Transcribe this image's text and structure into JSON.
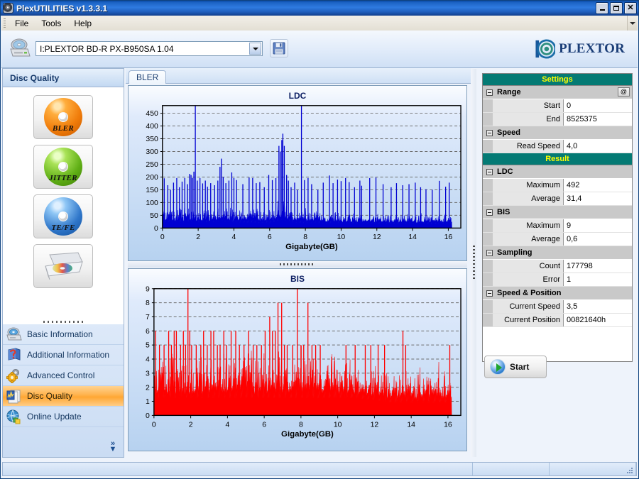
{
  "window": {
    "title": "PlexUTILITIES v1.3.3.1",
    "icon": "disc-icon",
    "buttons": {
      "minimize": "_",
      "maximize": "□",
      "close": "✕"
    }
  },
  "menu": {
    "items": [
      "File",
      "Tools",
      "Help"
    ],
    "expander": "chevron-down-icon"
  },
  "toolbar": {
    "drive_icon": "optical-drive-icon",
    "drive_value": "I:PLEXTOR BD-R  PX-B950SA  1.04",
    "dropdown_icon": "chevron-down-icon",
    "save_icon": "floppy-save-icon",
    "brand": "PLEXTOR",
    "brand_suffix": "®"
  },
  "sidebar": {
    "header": "Disc Quality",
    "big_buttons": [
      {
        "name": "bler",
        "label": "BLER",
        "icon": "orange-disc-icon"
      },
      {
        "name": "jitter",
        "label": "JITTER",
        "icon": "green-disc-icon"
      },
      {
        "name": "tefe",
        "label": "TE/FE",
        "icon": "blue-disc-icon"
      },
      {
        "name": "drive",
        "label": "",
        "icon": "drive-tray-icon"
      }
    ],
    "nav": [
      {
        "label": "Basic Information",
        "icon": "disc-drive-icon",
        "selected": false
      },
      {
        "label": "Additional Information",
        "icon": "book-help-icon",
        "selected": false
      },
      {
        "label": "Advanced Control",
        "icon": "gears-icon",
        "selected": false
      },
      {
        "label": "Disc Quality",
        "icon": "chart-pages-icon",
        "selected": true
      },
      {
        "label": "Online Update",
        "icon": "globe-update-icon",
        "selected": false
      }
    ],
    "expander": "chevrons-down-icon"
  },
  "main": {
    "tabs": [
      {
        "label": "BLER",
        "active": true
      }
    ]
  },
  "properties": {
    "sections": [
      {
        "type": "category",
        "label": "Settings",
        "groups": [
          {
            "label": "Range",
            "action": "@",
            "rows": [
              {
                "key": "Start",
                "value": "0"
              },
              {
                "key": "End",
                "value": "8525375"
              }
            ]
          },
          {
            "label": "Speed",
            "action": "",
            "rows": [
              {
                "key": "Read Speed",
                "value": "4,0"
              }
            ]
          }
        ]
      },
      {
        "type": "category",
        "label": "Result",
        "groups": [
          {
            "label": "LDC",
            "action": "",
            "rows": [
              {
                "key": "Maximum",
                "value": "492"
              },
              {
                "key": "Average",
                "value": "31,4"
              }
            ]
          },
          {
            "label": "BIS",
            "action": "",
            "rows": [
              {
                "key": "Maximum",
                "value": "9"
              },
              {
                "key": "Average",
                "value": "0,6"
              }
            ]
          },
          {
            "label": "Sampling",
            "action": "",
            "rows": [
              {
                "key": "Count",
                "value": "177798"
              },
              {
                "key": "Error",
                "value": "1"
              }
            ]
          },
          {
            "label": "Speed & Position",
            "action": "",
            "rows": [
              {
                "key": "Current Speed",
                "value": "3,5"
              },
              {
                "key": "Current Position",
                "value": "00821640h"
              }
            ]
          }
        ]
      }
    ]
  },
  "start_button": {
    "label": "Start",
    "icon": "play-icon"
  },
  "statusbar": {
    "panels": [
      "",
      "",
      ""
    ],
    "sizegrip": "resize-grip-icon"
  },
  "chart_data": [
    {
      "type": "area",
      "title": "LDC",
      "xlabel": "Gigabyte(GB)",
      "ylabel": "",
      "color": "#0000d2",
      "xlim": [
        0,
        16.7
      ],
      "ylim": [
        0,
        480
      ],
      "xticks": [
        0,
        2,
        4,
        6,
        8,
        10,
        12,
        14,
        16
      ],
      "yticks": [
        0,
        50,
        100,
        150,
        200,
        250,
        300,
        350,
        400,
        450
      ],
      "grid": true,
      "legend": "none",
      "data_max": 492,
      "data_avg": 31.4,
      "baseline_envelope": [
        {
          "x": 0.0,
          "y": 78
        },
        {
          "x": 0.6,
          "y": 72
        },
        {
          "x": 1.2,
          "y": 70
        },
        {
          "x": 1.8,
          "y": 74
        },
        {
          "x": 2.6,
          "y": 68
        },
        {
          "x": 3.3,
          "y": 80
        },
        {
          "x": 4.0,
          "y": 70
        },
        {
          "x": 5.0,
          "y": 66
        },
        {
          "x": 6.0,
          "y": 64
        },
        {
          "x": 6.7,
          "y": 96
        },
        {
          "x": 7.4,
          "y": 68
        },
        {
          "x": 8.2,
          "y": 62
        },
        {
          "x": 9.3,
          "y": 58
        },
        {
          "x": 10.5,
          "y": 56
        },
        {
          "x": 11.1,
          "y": 60
        },
        {
          "x": 12.0,
          "y": 54
        },
        {
          "x": 13.0,
          "y": 52
        },
        {
          "x": 14.0,
          "y": 52
        },
        {
          "x": 15.0,
          "y": 50
        },
        {
          "x": 16.2,
          "y": 56
        }
      ],
      "spikes": [
        {
          "x": 0.1,
          "y": 195
        },
        {
          "x": 0.3,
          "y": 168
        },
        {
          "x": 0.45,
          "y": 150
        },
        {
          "x": 0.62,
          "y": 178
        },
        {
          "x": 0.8,
          "y": 196
        },
        {
          "x": 0.95,
          "y": 160
        },
        {
          "x": 1.1,
          "y": 182
        },
        {
          "x": 1.25,
          "y": 196
        },
        {
          "x": 1.4,
          "y": 172
        },
        {
          "x": 1.52,
          "y": 212
        },
        {
          "x": 1.6,
          "y": 208
        },
        {
          "x": 1.68,
          "y": 196
        },
        {
          "x": 1.76,
          "y": 221
        },
        {
          "x": 1.84,
          "y": 492
        },
        {
          "x": 1.95,
          "y": 186
        },
        {
          "x": 2.1,
          "y": 196
        },
        {
          "x": 2.25,
          "y": 175
        },
        {
          "x": 2.4,
          "y": 186
        },
        {
          "x": 2.52,
          "y": 162
        },
        {
          "x": 2.7,
          "y": 176
        },
        {
          "x": 2.92,
          "y": 168
        },
        {
          "x": 3.1,
          "y": 186
        },
        {
          "x": 3.22,
          "y": 240
        },
        {
          "x": 3.3,
          "y": 272
        },
        {
          "x": 3.4,
          "y": 200
        },
        {
          "x": 3.55,
          "y": 176
        },
        {
          "x": 3.72,
          "y": 186
        },
        {
          "x": 3.88,
          "y": 218
        },
        {
          "x": 4.0,
          "y": 196
        },
        {
          "x": 4.15,
          "y": 188
        },
        {
          "x": 4.5,
          "y": 172
        },
        {
          "x": 4.85,
          "y": 198
        },
        {
          "x": 5.05,
          "y": 196
        },
        {
          "x": 5.25,
          "y": 176
        },
        {
          "x": 5.45,
          "y": 180
        },
        {
          "x": 5.7,
          "y": 160
        },
        {
          "x": 5.95,
          "y": 208
        },
        {
          "x": 6.15,
          "y": 188
        },
        {
          "x": 6.35,
          "y": 196
        },
        {
          "x": 6.52,
          "y": 322
        },
        {
          "x": 6.6,
          "y": 300
        },
        {
          "x": 6.68,
          "y": 345
        },
        {
          "x": 6.74,
          "y": 370
        },
        {
          "x": 6.82,
          "y": 322
        },
        {
          "x": 6.95,
          "y": 208
        },
        {
          "x": 7.05,
          "y": 186
        },
        {
          "x": 7.2,
          "y": 160
        },
        {
          "x": 7.4,
          "y": 178
        },
        {
          "x": 7.55,
          "y": 150
        },
        {
          "x": 7.78,
          "y": 492
        },
        {
          "x": 7.95,
          "y": 188
        },
        {
          "x": 8.15,
          "y": 196
        },
        {
          "x": 8.35,
          "y": 172
        },
        {
          "x": 8.7,
          "y": 150
        },
        {
          "x": 9.0,
          "y": 178
        },
        {
          "x": 9.35,
          "y": 206
        },
        {
          "x": 9.55,
          "y": 176
        },
        {
          "x": 9.8,
          "y": 190
        },
        {
          "x": 10.0,
          "y": 184
        },
        {
          "x": 10.25,
          "y": 196
        },
        {
          "x": 10.45,
          "y": 180
        },
        {
          "x": 10.75,
          "y": 160
        },
        {
          "x": 11.05,
          "y": 186
        },
        {
          "x": 11.15,
          "y": 166
        },
        {
          "x": 11.6,
          "y": 196
        },
        {
          "x": 11.95,
          "y": 198
        },
        {
          "x": 12.35,
          "y": 172
        },
        {
          "x": 12.8,
          "y": 160
        },
        {
          "x": 13.1,
          "y": 176
        },
        {
          "x": 13.45,
          "y": 168
        },
        {
          "x": 13.8,
          "y": 172
        },
        {
          "x": 14.15,
          "y": 178
        },
        {
          "x": 14.45,
          "y": 160
        },
        {
          "x": 14.75,
          "y": 152
        },
        {
          "x": 15.1,
          "y": 150
        },
        {
          "x": 15.5,
          "y": 185
        },
        {
          "x": 15.85,
          "y": 162
        },
        {
          "x": 16.05,
          "y": 178
        }
      ]
    },
    {
      "type": "area",
      "title": "BIS",
      "xlabel": "Gigabyte(GB)",
      "ylabel": "",
      "color": "#fe0000",
      "xlim": [
        0,
        16.7
      ],
      "ylim": [
        0,
        9
      ],
      "xticks": [
        0,
        2,
        4,
        6,
        8,
        10,
        12,
        14,
        16
      ],
      "yticks": [
        0,
        1,
        2,
        3,
        4,
        5,
        6,
        7,
        8,
        9
      ],
      "grid": true,
      "legend": "none",
      "data_max": 9,
      "data_avg": 0.6,
      "baseline_envelope": [
        {
          "x": 0.0,
          "y": 4
        },
        {
          "x": 4.0,
          "y": 4
        },
        {
          "x": 8.0,
          "y": 4
        },
        {
          "x": 9.2,
          "y": 4
        },
        {
          "x": 11.0,
          "y": 4
        },
        {
          "x": 12.9,
          "y": 3
        },
        {
          "x": 14.0,
          "y": 3
        },
        {
          "x": 16.2,
          "y": 3
        }
      ],
      "spikes": [
        {
          "x": 0.08,
          "y": 6
        },
        {
          "x": 0.3,
          "y": 5
        },
        {
          "x": 0.55,
          "y": 5
        },
        {
          "x": 0.8,
          "y": 6
        },
        {
          "x": 0.95,
          "y": 5
        },
        {
          "x": 1.1,
          "y": 6
        },
        {
          "x": 1.22,
          "y": 6
        },
        {
          "x": 1.45,
          "y": 5
        },
        {
          "x": 1.6,
          "y": 6
        },
        {
          "x": 1.72,
          "y": 5
        },
        {
          "x": 1.85,
          "y": 9
        },
        {
          "x": 1.95,
          "y": 6
        },
        {
          "x": 2.05,
          "y": 5
        },
        {
          "x": 2.3,
          "y": 5
        },
        {
          "x": 2.55,
          "y": 5
        },
        {
          "x": 2.7,
          "y": 6
        },
        {
          "x": 2.9,
          "y": 5
        },
        {
          "x": 3.1,
          "y": 6
        },
        {
          "x": 3.25,
          "y": 6
        },
        {
          "x": 3.45,
          "y": 5
        },
        {
          "x": 3.6,
          "y": 5
        },
        {
          "x": 3.8,
          "y": 6
        },
        {
          "x": 3.95,
          "y": 5
        },
        {
          "x": 4.2,
          "y": 6
        },
        {
          "x": 4.45,
          "y": 6
        },
        {
          "x": 4.65,
          "y": 5
        },
        {
          "x": 4.9,
          "y": 5
        },
        {
          "x": 5.15,
          "y": 6
        },
        {
          "x": 5.4,
          "y": 5
        },
        {
          "x": 5.6,
          "y": 5
        },
        {
          "x": 5.85,
          "y": 5
        },
        {
          "x": 6.05,
          "y": 6
        },
        {
          "x": 6.3,
          "y": 7
        },
        {
          "x": 6.45,
          "y": 6
        },
        {
          "x": 6.6,
          "y": 6
        },
        {
          "x": 6.75,
          "y": 8
        },
        {
          "x": 6.95,
          "y": 8
        },
        {
          "x": 7.1,
          "y": 5
        },
        {
          "x": 7.25,
          "y": 5
        },
        {
          "x": 7.55,
          "y": 5
        },
        {
          "x": 7.8,
          "y": 9
        },
        {
          "x": 8.0,
          "y": 5
        },
        {
          "x": 8.15,
          "y": 5
        },
        {
          "x": 8.38,
          "y": 8
        },
        {
          "x": 8.6,
          "y": 5
        },
        {
          "x": 8.8,
          "y": 5
        },
        {
          "x": 9.05,
          "y": 5
        },
        {
          "x": 10.45,
          "y": 5
        },
        {
          "x": 10.95,
          "y": 5
        },
        {
          "x": 11.5,
          "y": 5
        },
        {
          "x": 11.8,
          "y": 5
        },
        {
          "x": 12.2,
          "y": 5
        },
        {
          "x": 12.55,
          "y": 5
        },
        {
          "x": 13.55,
          "y": 6
        },
        {
          "x": 13.7,
          "y": 5
        },
        {
          "x": 16.1,
          "y": 5
        }
      ]
    }
  ]
}
